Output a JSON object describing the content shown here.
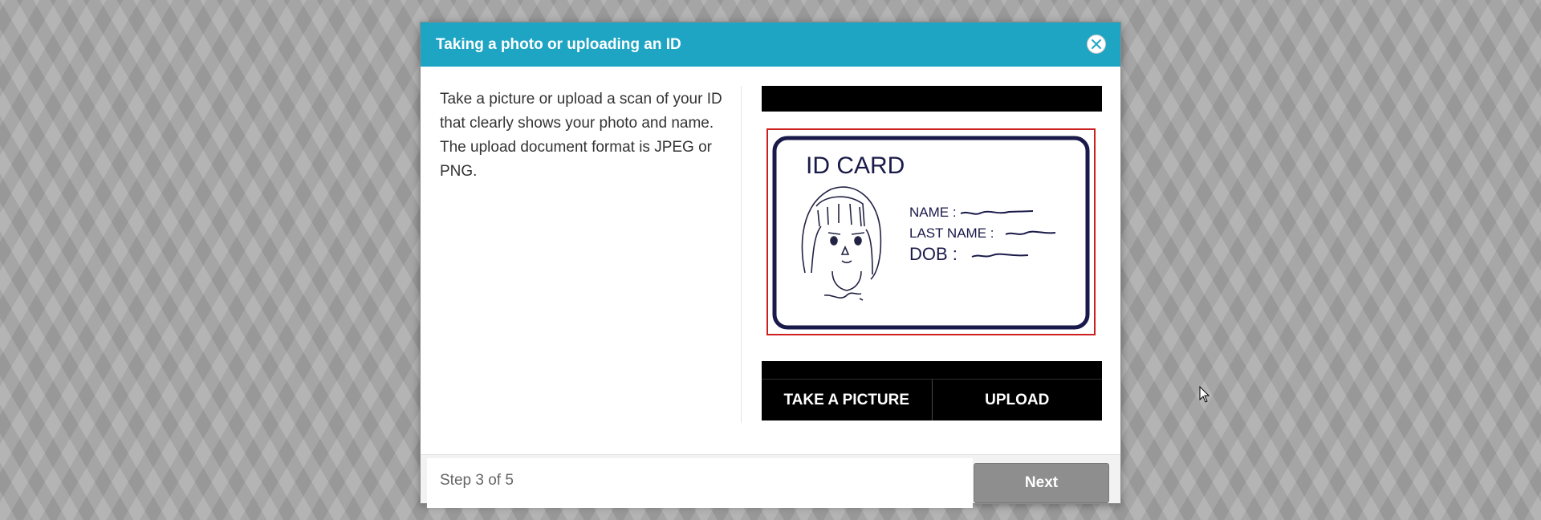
{
  "modal": {
    "title": "Taking a photo or uploading an ID",
    "instructions": "Take a picture or upload a scan of your ID that clearly shows your photo and name. The upload document format is JPEG or PNG."
  },
  "id_card": {
    "heading": "ID CARD",
    "fields": [
      "NAME :",
      "LAST NAME :",
      "DOB :"
    ]
  },
  "actions": {
    "take_picture": "TAKE A PICTURE",
    "upload": "UPLOAD"
  },
  "footer": {
    "step_text": "Step 3 of 5",
    "next_label": "Next"
  },
  "colors": {
    "header": "#1fa5c4",
    "guide_frame": "#cc1f1f",
    "next_disabled": "#8e8e8e"
  },
  "icons": [
    "close-icon",
    "id-card-illustration",
    "mouse-cursor-icon"
  ]
}
